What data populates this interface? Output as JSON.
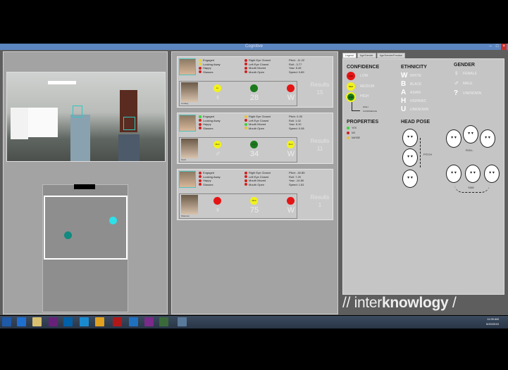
{
  "window": {
    "title": "Cognitive",
    "min": "–",
    "max": "□",
    "close": "×"
  },
  "legend_tabs": [
    "Legend",
    "Age/Gender",
    "Age/Gender/Emotion"
  ],
  "cards": [
    {
      "props1": [
        {
          "l": "Engaged",
          "c": "#e6d23a"
        },
        {
          "l": "Looking Away",
          "c": "#e6d23a"
        },
        {
          "l": "Happy",
          "c": "#d02020"
        },
        {
          "l": "Glasses",
          "c": "#d02020"
        }
      ],
      "props2": [
        {
          "l": "Right Eye Closed",
          "c": "#d02020"
        },
        {
          "l": "Left Eye Closed",
          "c": "#d02020"
        },
        {
          "l": "Mouth Moved",
          "c": "#d02020"
        },
        {
          "l": "Mouth Open",
          "c": "#d02020"
        }
      ],
      "pose": [
        "Pitch: -11.22",
        "Roll: -3.77",
        "Yaw: 5.45",
        "Speed: 0.89"
      ],
      "circles": [
        {
          "c": "#f2f21c",
          "v": "Lo",
          "l": "♀"
        },
        {
          "c": "#1c7a1c",
          "v": "",
          "l": "28"
        },
        {
          "c": "#e51414",
          "v": "",
          "l": "W"
        }
      ],
      "person": "Lindsay",
      "results_label": "Results",
      "results": "15"
    },
    {
      "props1": [
        {
          "l": "Engaged",
          "c": "#3ad23a"
        },
        {
          "l": "Looking Away",
          "c": "#d02020"
        },
        {
          "l": "Happy",
          "c": "#d02020"
        },
        {
          "l": "Glasses",
          "c": "#d02020"
        }
      ],
      "props2": [
        {
          "l": "Right Eye Closed",
          "c": "#e6c23a"
        },
        {
          "l": "Left Eye Closed",
          "c": "#d02020"
        },
        {
          "l": "Mouth Moved",
          "c": "#3ad23a"
        },
        {
          "l": "Mouth Open",
          "c": "#e6c23a"
        }
      ],
      "pose": [
        "Pitch: 0.25",
        "Roll: 1.02",
        "Yaw: 5.10",
        "Speed: 0.08"
      ],
      "circles": [
        {
          "c": "#f2f21c",
          "v": "Med",
          "l": "♂"
        },
        {
          "c": "#1c7a1c",
          "v": "High",
          "l": "34"
        },
        {
          "c": "#f2f21c",
          "v": "Med",
          "l": "W"
        }
      ],
      "person": "Scott",
      "results_label": "Results",
      "results": "11"
    },
    {
      "props1": [
        {
          "l": "Engaged",
          "c": "#d02020"
        },
        {
          "l": "Looking Away",
          "c": "#d02020"
        },
        {
          "l": "Happy",
          "c": "#d02020"
        },
        {
          "l": "Glasses",
          "c": "#d02020"
        }
      ],
      "props2": [
        {
          "l": "Right Eye Closed",
          "c": "#d02020"
        },
        {
          "l": "Left Eye Closed",
          "c": "#d02020"
        },
        {
          "l": "Mouth Moved",
          "c": "#d02020"
        },
        {
          "l": "Mouth Open",
          "c": "#d02020"
        }
      ],
      "pose": [
        "Pitch: -40.85",
        "Roll: 7.29",
        "Yaw: -14.80",
        "Speed: 1.81"
      ],
      "circles": [
        {
          "c": "#e51414",
          "v": "",
          "l": "♀"
        },
        {
          "c": "#f2f21c",
          "v": "Med",
          "l": "75"
        },
        {
          "c": "#e51414",
          "v": "",
          "l": "W"
        }
      ],
      "person": "Shannon",
      "results_label": "Results",
      "results": "1"
    }
  ],
  "legend": {
    "confidence": {
      "title": "CONFIDENCE",
      "low": "LOW",
      "medium": "MEDIUM",
      "high": "HIGH",
      "badge_low": "Low",
      "badge_med": "Med",
      "badge_high": "High",
      "note1": "HIGH",
      "note2": "CONFIDENCE"
    },
    "ethnicity": {
      "title": "ETHNICITY",
      "items": [
        {
          "k": "W",
          "l": "WHITE"
        },
        {
          "k": "B",
          "l": "BLACK"
        },
        {
          "k": "A",
          "l": "ASIAN"
        },
        {
          "k": "H",
          "l": "HISPANIC"
        },
        {
          "k": "U",
          "l": "UNKNOWN"
        }
      ]
    },
    "gender": {
      "title": "GENDER",
      "items": [
        {
          "k": "♀",
          "l": "FEMALE"
        },
        {
          "k": "♂",
          "l": "MALE"
        },
        {
          "k": "?",
          "l": "UNKNOWN"
        }
      ]
    },
    "properties": {
      "title": "PROPERTIES",
      "items": [
        {
          "l": "YES",
          "c": "#3ad23a"
        },
        {
          "l": "NO",
          "c": "#d02020"
        },
        {
          "l": "MAYBE",
          "c": "#e6c23a"
        }
      ]
    },
    "headpose": {
      "title": "HEAD POSE",
      "pitch": "PITCH",
      "roll": "ROLL",
      "yaw": "YAW"
    }
  },
  "brand": {
    "pre": "// inter",
    "bold": "knowlogy",
    "post": " /"
  },
  "taskbar": {
    "icons": [
      "start",
      "ie",
      "explorer",
      "visual-studio",
      "outlook",
      "app",
      "chrome",
      "media",
      "lync",
      "onenote",
      "camtasia",
      "app2"
    ],
    "clock": "11:09 AM",
    "date": "5/20/2015"
  }
}
